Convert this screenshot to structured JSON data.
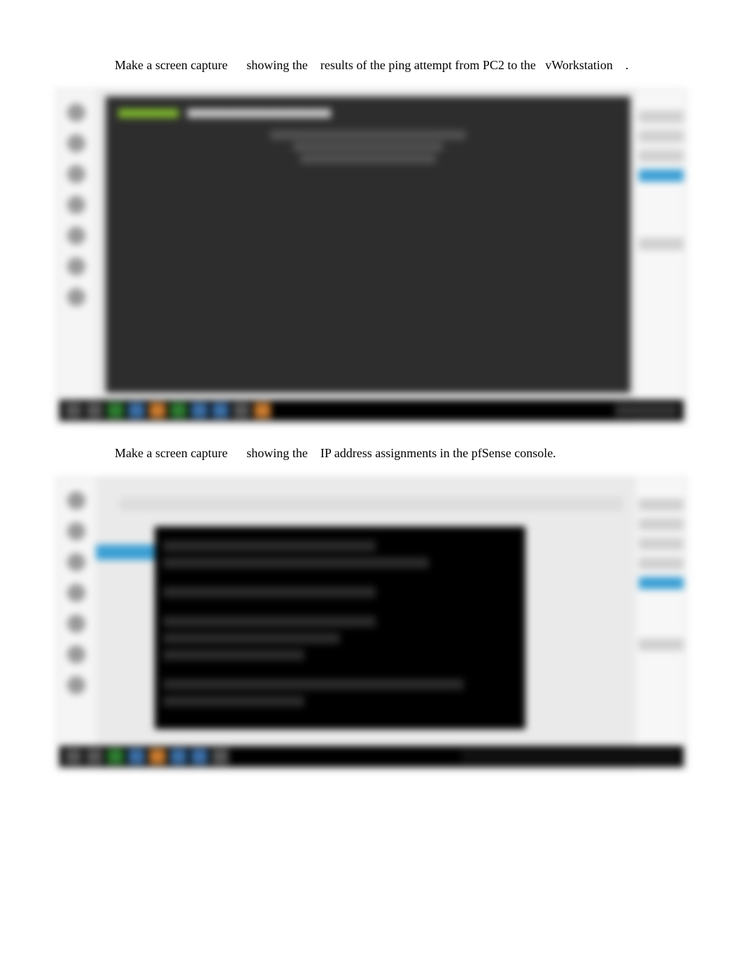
{
  "instruction1": {
    "part1": "Make a screen capture",
    "part2": "showing the",
    "part3": "results of the ping attempt from PC2 to the",
    "part4": "vWorkstation",
    "part5": "."
  },
  "instruction2": {
    "part1": "Make a screen capture",
    "part2": "showing the",
    "part3": "IP address assignments in the pfSense console."
  },
  "bullet_glyph": "",
  "screenshots": {
    "s1_alt": "Terminal window showing ping results",
    "s2_alt": "pfSense console showing IP address assignments"
  }
}
